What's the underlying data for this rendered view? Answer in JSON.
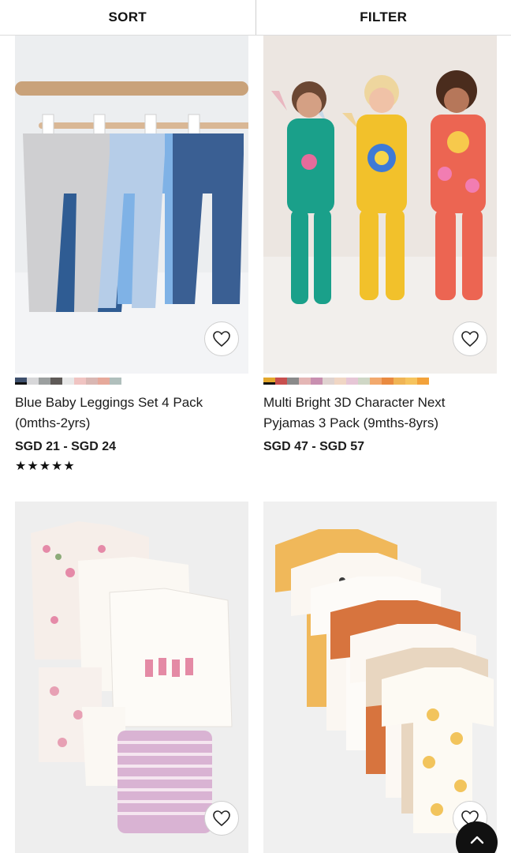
{
  "toolbar": {
    "sort_label": "SORT",
    "filter_label": "FILTER"
  },
  "products": [
    {
      "title": "Blue Baby Leggings Set 4 Pack (0mths-2yrs)",
      "price": "SGD 21 - SGD 24",
      "rating_stars": 5,
      "swatches": [
        "#3d4f6c",
        "#d7d7d9",
        "#9b9f9f",
        "#5e5a57",
        "#e8e8e8",
        "#f0c4c2",
        "#d9b7b3",
        "#e6a99b",
        "#b0bfbc"
      ]
    },
    {
      "title": "Multi Bright 3D Character Next Pyjamas 3 Pack (9mths-8yrs)",
      "price": "SGD 47 - SGD 57",
      "swatches": [
        "#e3a72b",
        "#c84f4e",
        "#8a8a8a",
        "#e4b6b5",
        "#c88fb0",
        "#dfd3d0",
        "#f0d6c4",
        "#e6c6d6",
        "#cfd7c6",
        "#f2a96e",
        "#e98a40",
        "#f0b455",
        "#f6c45e",
        "#f3a23a"
      ]
    },
    {
      "title": "",
      "price": ""
    },
    {
      "title": "",
      "price": ""
    }
  ],
  "colors": {
    "accent": "#111111",
    "border": "#dcdcdc"
  },
  "icons": {
    "favourite": "heart-outline-icon",
    "scroll_top": "chevron-up-icon",
    "rating": "star-icon"
  }
}
